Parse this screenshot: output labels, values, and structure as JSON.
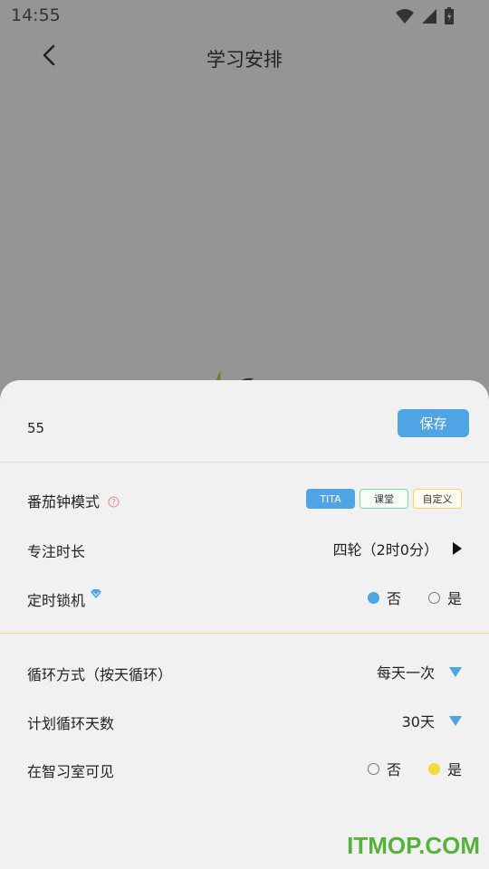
{
  "status_bar": {
    "time": "14:55"
  },
  "app_bar": {
    "title": "学习安排"
  },
  "sheet": {
    "counter": "55",
    "save_label": "保存",
    "rows": {
      "mode": {
        "label": "番茄钟模式",
        "options": [
          "TITA",
          "课堂",
          "自定义"
        ],
        "selected": "TITA"
      },
      "focus": {
        "label": "专注时长",
        "value": "四轮（2时0分）"
      },
      "lock": {
        "label": "定时锁机",
        "no": "否",
        "yes": "是",
        "selected": "否"
      },
      "cycle": {
        "label": "循环方式（按天循环）",
        "value": "每天一次"
      },
      "days": {
        "label": "计划循环天数",
        "value": "30天"
      },
      "visible": {
        "label": "在智习室可见",
        "no": "否",
        "yes": "是",
        "selected": "是"
      }
    }
  },
  "watermark": "ITMOP.COM",
  "colors": {
    "accent": "#4ea4e4",
    "yellow": "#f3db3a",
    "green_chip": "#7ddba0"
  }
}
